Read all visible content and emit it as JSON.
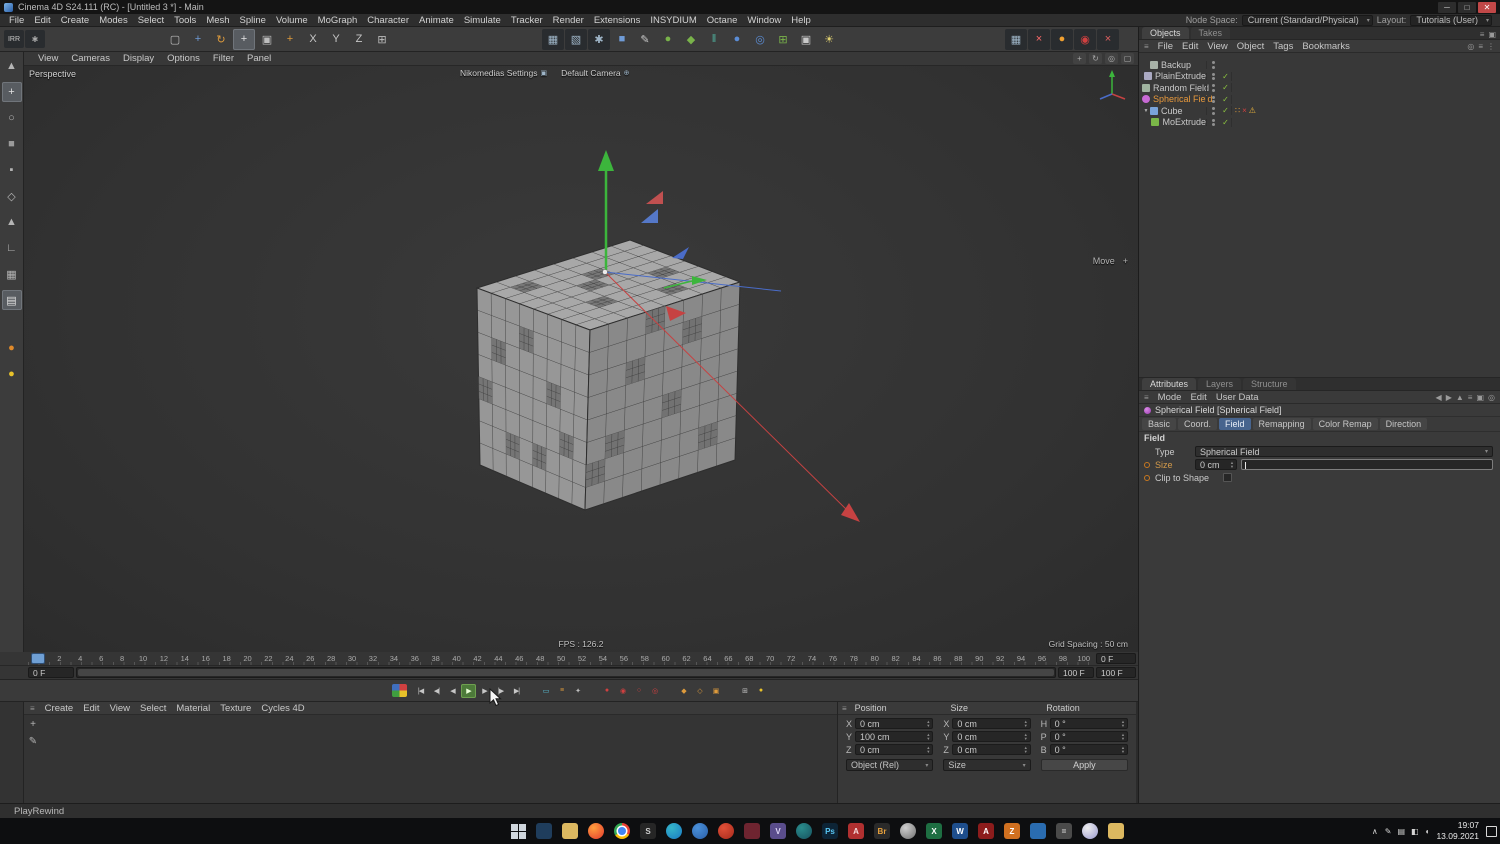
{
  "window": {
    "title": "Cinema 4D S24.111 (RC) - [Untitled 3 *] - Main",
    "minimize": "─",
    "maximize": "□",
    "close": "✕",
    "menus": [
      "File",
      "Edit",
      "Create",
      "Modes",
      "Select",
      "Tools",
      "Mesh",
      "Spline",
      "Volume",
      "MoGraph",
      "Character",
      "Animate",
      "Simulate",
      "Tracker",
      "Render",
      "Extensions",
      "INSYDIUM",
      "Octane",
      "Window",
      "Help"
    ],
    "node_space_label": "Node Space:",
    "node_space_value": "Current (Standard/Physical)",
    "layout_label": "Layout:",
    "layout_value": "Tutorials (User)"
  },
  "toolbar": {
    "far_left": [
      {
        "name": "irr-button",
        "glyph": "IRR",
        "color": "#c9c9c9",
        "dark": true
      },
      {
        "name": "settings-gear-icon",
        "glyph": "✱",
        "color": "#a9a9a9",
        "dark": true
      }
    ],
    "left": [
      {
        "name": "live-selection-tool",
        "glyph": "▢",
        "color": "#bdbdbd"
      },
      {
        "name": "move-tool",
        "glyph": "+",
        "color": "#6f9bd6"
      },
      {
        "name": "rotate-tool",
        "glyph": "↻",
        "color": "#de9b3c"
      },
      {
        "name": "active-tool-move",
        "glyph": "+",
        "color": "#e4e4e4",
        "active": true
      },
      {
        "name": "scale-tool",
        "glyph": "▣",
        "color": "#bdbdbd"
      },
      {
        "name": "add-tool",
        "glyph": "+",
        "color": "#de9b3c"
      },
      {
        "name": "lock-x-axis",
        "glyph": "X",
        "color": "#c6c6c6"
      },
      {
        "name": "lock-y-axis",
        "glyph": "Y",
        "color": "#c6c6c6"
      },
      {
        "name": "lock-z-axis",
        "glyph": "Z",
        "color": "#c6c6c6"
      },
      {
        "name": "coordinate-system",
        "glyph": "⊞",
        "color": "#bdbdbd"
      }
    ],
    "center": [
      {
        "name": "render-view",
        "glyph": "▦",
        "color": "#9fb6c9",
        "dark": true
      },
      {
        "name": "render-region",
        "glyph": "▧",
        "color": "#9fb6c9",
        "dark": true
      },
      {
        "name": "render-settings",
        "glyph": "✱",
        "color": "#9fb6c9",
        "dark": true
      },
      {
        "name": "primitive-cube",
        "glyph": "■",
        "color": "#6f9bd6"
      },
      {
        "name": "pen-spline",
        "glyph": "✎",
        "color": "#c9c9c9"
      },
      {
        "name": "subdivision-surface",
        "glyph": "●",
        "color": "#79b34a"
      },
      {
        "name": "generators",
        "glyph": "◆",
        "color": "#79b34a"
      },
      {
        "name": "symmetry",
        "glyph": "‖",
        "color": "#4fae9b"
      },
      {
        "name": "volume",
        "glyph": "●",
        "color": "#5b8dd6"
      },
      {
        "name": "fields",
        "glyph": "◎",
        "color": "#5b8dd6"
      },
      {
        "name": "mograph-array",
        "glyph": "⊞",
        "color": "#79b34a"
      },
      {
        "name": "camera",
        "glyph": "▣",
        "color": "#c9c9c9"
      },
      {
        "name": "light",
        "glyph": "☀",
        "color": "#e0d070"
      }
    ],
    "right": [
      {
        "name": "irr-window",
        "glyph": "▦",
        "color": "#9fb6c9",
        "dark": true
      },
      {
        "name": "octane-stop",
        "glyph": "×",
        "color": "#ff6a6a",
        "dark": true
      },
      {
        "name": "octane-live",
        "glyph": "●",
        "color": "#f0a030",
        "dark": true
      },
      {
        "name": "octane-render",
        "glyph": "◉",
        "color": "#d04040",
        "dark": true
      },
      {
        "name": "octane-abort",
        "glyph": "×",
        "color": "#e06060",
        "dark": true
      }
    ]
  },
  "left_toolbar": [
    {
      "name": "pointer-tool",
      "glyph": "▲",
      "color": "#b5b5b5"
    },
    {
      "name": "move-mode",
      "glyph": "+",
      "color": "#e0e0e0",
      "active": true
    },
    {
      "name": "rotate-ring",
      "glyph": "○",
      "color": "#b5b5b5"
    },
    {
      "name": "model-mode",
      "glyph": "■",
      "color": "#9a9a9a"
    },
    {
      "name": "points-mode",
      "glyph": "▪",
      "color": "#b5b5b5"
    },
    {
      "name": "edges-mode",
      "glyph": "◇",
      "color": "#b5b5b5"
    },
    {
      "name": "polygons-mode",
      "glyph": "▲",
      "color": "#b5b5b5"
    },
    {
      "name": "axis-mode",
      "glyph": "∟",
      "color": "#b5b5b5"
    },
    {
      "name": "texture-mode",
      "glyph": "▦",
      "color": "#b5b5b5"
    },
    {
      "name": "workplane-mode",
      "glyph": "▤",
      "color": "#e0e0e0",
      "active": true
    },
    {
      "name": "material-sphere",
      "glyph": "●",
      "color": "#e08a2a",
      "gap": true
    },
    {
      "name": "cycles-sphere",
      "glyph": "●",
      "color": "#e8c22a"
    }
  ],
  "viewport": {
    "label": "Perspective",
    "menus": [
      "View",
      "Cameras",
      "Display",
      "Options",
      "Filter",
      "Panel"
    ],
    "corner_buttons": [
      {
        "name": "pan-view-icon",
        "glyph": "+"
      },
      {
        "name": "orbit-view-icon",
        "glyph": "↻"
      },
      {
        "name": "zoom-view-icon",
        "glyph": "◎"
      },
      {
        "name": "maximize-view-icon",
        "glyph": "▢"
      }
    ],
    "hud": [
      {
        "name": "hud-nikomedias-settings",
        "label": "Nikomedias Settings",
        "icon": "▣"
      },
      {
        "name": "hud-default-camera",
        "label": "Default Camera",
        "icon": "⊕"
      }
    ],
    "tool_hint": "Move",
    "tool_hint_plus": "+",
    "fps": "FPS : 126.2",
    "grid_spacing": "Grid Spacing : 50 cm"
  },
  "timeline": {
    "ticks": [
      0,
      2,
      4,
      6,
      8,
      10,
      12,
      14,
      16,
      18,
      20,
      22,
      24,
      26,
      28,
      30,
      32,
      34,
      36,
      38,
      40,
      42,
      44,
      46,
      48,
      50,
      52,
      54,
      56,
      58,
      60,
      62,
      64,
      66,
      68,
      70,
      72,
      74,
      76,
      78,
      80,
      82,
      84,
      86,
      88,
      90,
      92,
      94,
      96,
      98,
      100
    ],
    "current_frame_field": "0 F",
    "range_start": "0 F",
    "range_end": "100 F",
    "end_field": "100 F"
  },
  "transport": {
    "play_buttons": [
      {
        "name": "goto-start",
        "glyph": "|◀"
      },
      {
        "name": "prev-key",
        "glyph": "◀|"
      },
      {
        "name": "prev-frame",
        "glyph": "◀"
      },
      {
        "name": "play-forward",
        "glyph": "▶",
        "active": true
      },
      {
        "name": "next-frame",
        "glyph": "▶"
      },
      {
        "name": "next-key",
        "glyph": "|▶"
      },
      {
        "name": "goto-end",
        "glyph": "▶|"
      }
    ],
    "toggle_buttons": [
      {
        "name": "sound-toggle",
        "glyph": "▭",
        "color": "#59c0d8"
      },
      {
        "name": "keyframe-list",
        "glyph": "≡",
        "color": "#de9b3c"
      },
      {
        "name": "key-tool",
        "glyph": "✦",
        "color": "#bdbdbd"
      }
    ],
    "record_buttons": [
      {
        "name": "record-keyframe",
        "glyph": "●",
        "color": "#d04040"
      },
      {
        "name": "record-position",
        "glyph": "◉",
        "color": "#d04040"
      },
      {
        "name": "record-scale",
        "glyph": "○",
        "color": "#d04040"
      },
      {
        "name": "record-rotation",
        "glyph": "◎",
        "color": "#d04040"
      }
    ],
    "key_buttons": [
      {
        "name": "keyframe-add",
        "glyph": "◆",
        "color": "#de9b3c"
      },
      {
        "name": "keyframe-remove",
        "glyph": "◇",
        "color": "#de9b3c"
      },
      {
        "name": "autokey-toggle",
        "glyph": "▣",
        "color": "#de9b3c"
      }
    ],
    "misc_buttons": [
      {
        "name": "snap-grid",
        "glyph": "⊞",
        "color": "#bdbdbd"
      },
      {
        "name": "simulation-sphere",
        "glyph": "●",
        "color": "#e8c22a"
      }
    ]
  },
  "materials": {
    "menus": [
      "Create",
      "Edit",
      "View",
      "Select",
      "Material",
      "Texture",
      "Cycles 4D"
    ],
    "side_icons": [
      {
        "name": "add-material-icon",
        "glyph": "+"
      },
      {
        "name": "pen-icon",
        "glyph": "✎"
      }
    ]
  },
  "coordinates": {
    "groups": [
      {
        "title": "Position",
        "rows": [
          {
            "l": "X",
            "v": "0 cm"
          },
          {
            "l": "Y",
            "v": "100 cm"
          },
          {
            "l": "Z",
            "v": "0 cm"
          }
        ]
      },
      {
        "title": "Size",
        "rows": [
          {
            "l": "X",
            "v": "0 cm"
          },
          {
            "l": "Y",
            "v": "0 cm"
          },
          {
            "l": "Z",
            "v": "0 cm"
          }
        ]
      },
      {
        "title": "Rotation",
        "rows": [
          {
            "l": "H",
            "v": "0 °"
          },
          {
            "l": "P",
            "v": "0 °"
          },
          {
            "l": "B",
            "v": "0 °"
          }
        ]
      }
    ],
    "mode1": "Object (Rel)",
    "mode2": "Size",
    "apply": "Apply"
  },
  "objects_panel": {
    "tabs": [
      {
        "label": "Objects",
        "active": true
      },
      {
        "label": "Takes",
        "active": false
      }
    ],
    "corner_icons": [
      {
        "name": "panel-burger-icon",
        "glyph": "≡"
      },
      {
        "name": "panel-pin-icon",
        "glyph": "▣"
      }
    ],
    "menus": [
      "File",
      "Edit",
      "View",
      "Object",
      "Tags",
      "Bookmarks"
    ],
    "menubar_icons": [
      {
        "name": "search-icon",
        "glyph": "◎"
      },
      {
        "name": "filter-icon",
        "glyph": "≡"
      },
      {
        "name": "options-icon",
        "glyph": "⋮"
      }
    ],
    "items": [
      {
        "name": "Backup",
        "depth": 0,
        "caret": "",
        "icon_color": "#a8b2a8",
        "icon_shape": "square",
        "check": false,
        "selected": false,
        "tags": []
      },
      {
        "name": "PlainExtrude",
        "depth": 0,
        "caret": "",
        "icon_color": "#aaa9c2",
        "icon_shape": "square",
        "check": true,
        "selected": false,
        "tags": []
      },
      {
        "name": "Random Field",
        "depth": 0,
        "caret": "",
        "icon_color": "#9fb39f",
        "icon_shape": "square",
        "check": true,
        "selected": false,
        "tags": []
      },
      {
        "name": "Spherical Field",
        "depth": 0,
        "caret": "",
        "icon_color": "#c76ad4",
        "icon_shape": "circle",
        "check": true,
        "selected": true,
        "tags": []
      },
      {
        "name": "Cube",
        "depth": 0,
        "caret": "▼",
        "icon_color": "#7aa3d9",
        "icon_shape": "square",
        "check": true,
        "selected": false,
        "tags": [
          "dots",
          "cross",
          "warning"
        ]
      },
      {
        "name": "MoExtrude",
        "depth": 1,
        "caret": "",
        "icon_color": "#7ab648",
        "icon_shape": "square",
        "check": true,
        "selected": false,
        "tags": []
      }
    ],
    "tag_glyphs": {
      "dots": "∷",
      "cross": "×",
      "warning": "⚠"
    },
    "tag_colors": {
      "dots": "#e8a13c",
      "cross": "#d04040",
      "warning": "#e8b23c"
    }
  },
  "attributes": {
    "tabs": [
      {
        "label": "Attributes",
        "active": true
      },
      {
        "label": "Layers",
        "active": false
      },
      {
        "label": "Structure",
        "active": false
      }
    ],
    "menus": [
      "Mode",
      "Edit",
      "User Data"
    ],
    "menubar_icons": [
      {
        "name": "back-icon",
        "glyph": "◀"
      },
      {
        "name": "forward-icon",
        "glyph": "▶"
      },
      {
        "name": "up-icon",
        "glyph": "▲"
      },
      {
        "name": "filter-icon",
        "glyph": "≡"
      },
      {
        "name": "lock-icon",
        "glyph": "▣"
      },
      {
        "name": "pin-icon",
        "glyph": "◎"
      }
    ],
    "object_title": "Spherical Field [Spherical Field]",
    "section_tabs": [
      "Basic",
      "Coord.",
      "Field",
      "Remapping",
      "Color Remap",
      "Direction"
    ],
    "active_section_tab": "Field",
    "group_label": "Field",
    "rows": {
      "type_label": "Type",
      "type_value": "Spherical Field",
      "size_label": "Size",
      "size_value": "0 cm",
      "clip_label": "Clip to Shape"
    }
  },
  "statusbar": {
    "text": "PlayRewind"
  },
  "taskbar": {
    "apps": [
      {
        "name": "start-button",
        "kind": "start"
      },
      {
        "name": "app-monitor",
        "kind": "square",
        "color": "#1f3d5c"
      },
      {
        "name": "file-explorer",
        "kind": "square",
        "color": "#dcb860"
      },
      {
        "name": "firefox",
        "kind": "circle",
        "color1": "#ff9f3e",
        "color2": "#e3392e"
      },
      {
        "name": "chrome",
        "kind": "chrome"
      },
      {
        "name": "app-substance",
        "kind": "square",
        "color": "#262626",
        "label": "S",
        "label_color": "#cfcfcf"
      },
      {
        "name": "browser-teal",
        "kind": "circle",
        "color1": "#35b6c9",
        "color2": "#1a7ac4"
      },
      {
        "name": "app-blue-circle",
        "kind": "circle",
        "color1": "#4a90d9",
        "color2": "#2a5fa8"
      },
      {
        "name": "app-red-circle",
        "kind": "circle",
        "color1": "#e05038",
        "color2": "#a82a1c"
      },
      {
        "name": "app-maroon",
        "kind": "square",
        "color": "#6e2430"
      },
      {
        "name": "app-purple",
        "kind": "square",
        "color": "#5a4d8c",
        "label": "V",
        "label_color": "#ddd6f5"
      },
      {
        "name": "app-dark-teal",
        "kind": "circle",
        "color1": "#2a8c8c",
        "color2": "#17525f"
      },
      {
        "name": "photoshop",
        "kind": "square",
        "color": "#0d2436",
        "label": "Ps",
        "label_color": "#5ac8f5"
      },
      {
        "name": "app-red",
        "kind": "square",
        "color": "#b03030",
        "label": "A",
        "label_color": "#f3d9d9"
      },
      {
        "name": "bridge",
        "kind": "square",
        "color": "#2a2a2a",
        "label": "Br",
        "label_color": "#e8a13c"
      },
      {
        "name": "app-gray-sphere",
        "kind": "circle",
        "color1": "#cfcfcf",
        "color2": "#6f6f6f"
      },
      {
        "name": "excel",
        "kind": "square",
        "color": "#1e6e42",
        "label": "X",
        "label_color": "#ffffff"
      },
      {
        "name": "word",
        "kind": "square",
        "color": "#1e4e8c",
        "label": "W",
        "label_color": "#ffffff"
      },
      {
        "name": "acrobat",
        "kind": "square",
        "color": "#8c1c1c",
        "label": "A",
        "label_color": "#ffffff"
      },
      {
        "name": "app-orange",
        "kind": "square",
        "color": "#d07020",
        "label": "Z",
        "label_color": "#ffffff"
      },
      {
        "name": "app-blue",
        "kind": "square",
        "color": "#2a6cb0"
      },
      {
        "name": "calculator",
        "kind": "square",
        "color": "#4a4a4a",
        "label": "=",
        "label_color": "#dddddd"
      },
      {
        "name": "cinema4d-app",
        "kind": "circle",
        "color1": "#eeeeee",
        "color2": "#9a9ad0"
      },
      {
        "name": "folder-2",
        "kind": "square",
        "color": "#dcb860"
      }
    ],
    "tray": {
      "chevron": "∧",
      "icons": [
        {
          "name": "pen-icon",
          "glyph": "✎"
        },
        {
          "name": "keyboard-icon",
          "glyph": "▤"
        },
        {
          "name": "network-icon",
          "glyph": "◧"
        },
        {
          "name": "volume-icon",
          "glyph": "◖"
        }
      ],
      "time": "19:07",
      "date": "13.09.2021"
    }
  }
}
